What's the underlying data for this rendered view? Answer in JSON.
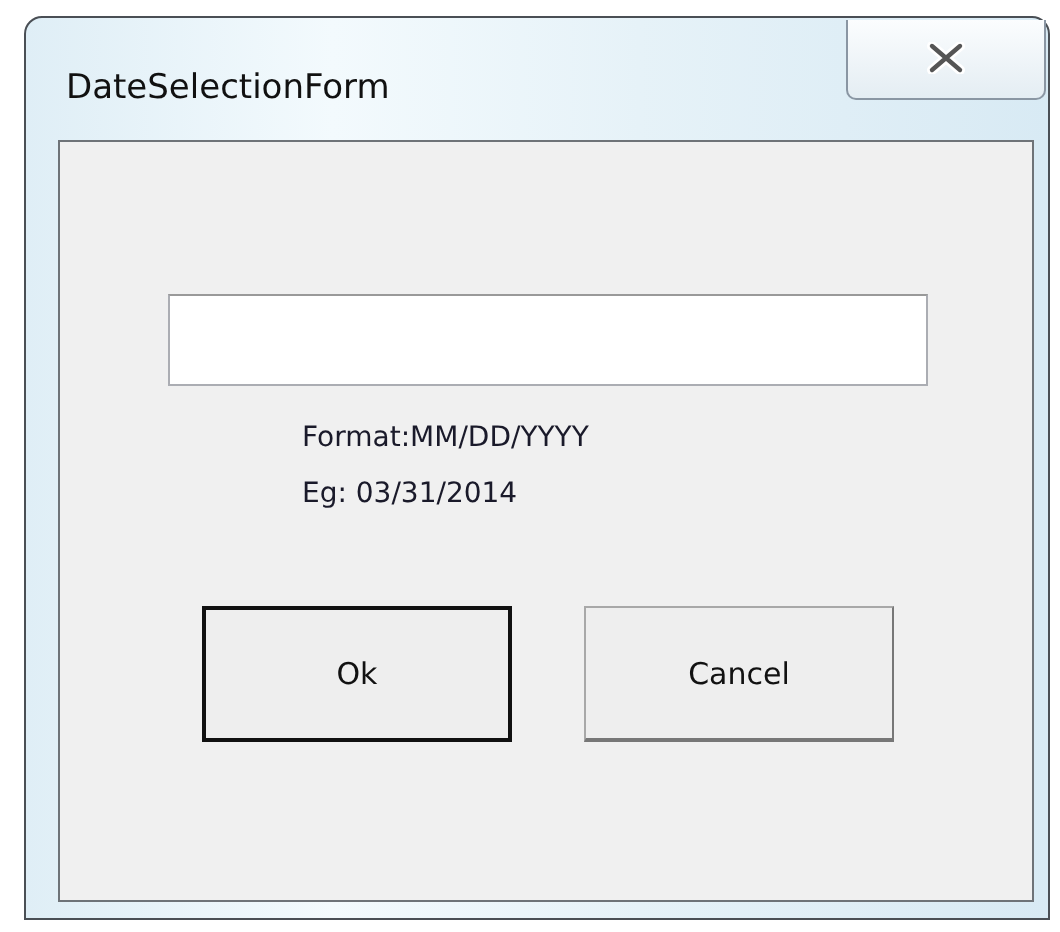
{
  "window": {
    "title": "DateSelectionForm"
  },
  "hint_lines": [
    "Format:MM/DD/YYYY",
    "Eg: 03/31/2014"
  ],
  "buttons": [
    {
      "label": "Ok",
      "default": true
    },
    {
      "label": "Cancel",
      "default": false
    }
  ]
}
